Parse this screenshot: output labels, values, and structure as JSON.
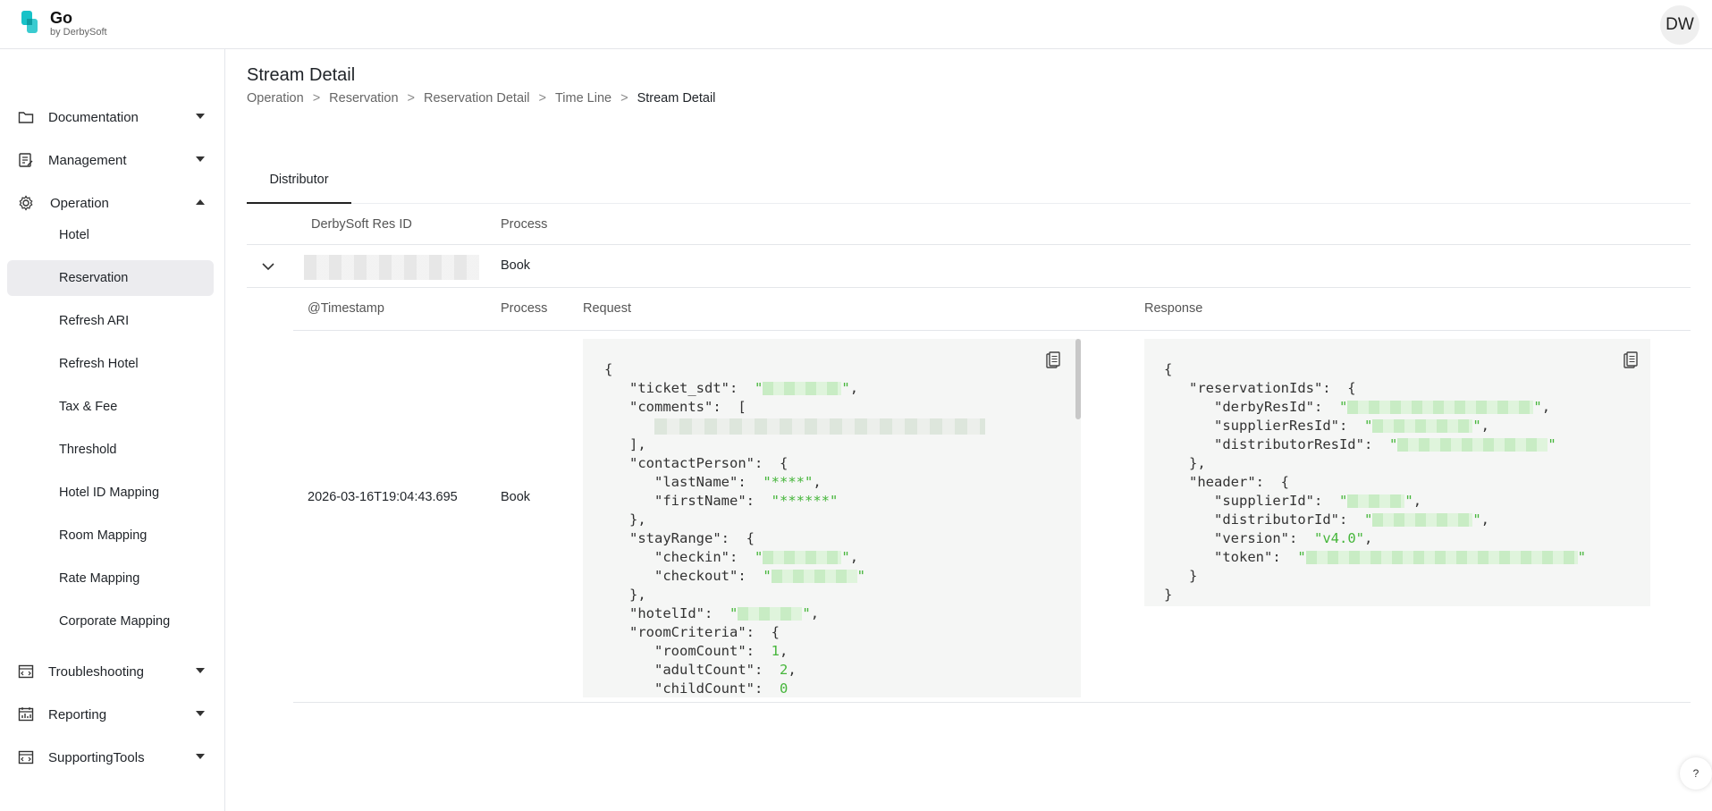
{
  "brand": {
    "name": "Go",
    "sub": "by DerbySoft",
    "logo_color": "#17c2c8"
  },
  "user": {
    "initials": "DW"
  },
  "sidebar": {
    "groups": [
      {
        "label": "Documentation",
        "icon": "folder-icon",
        "expanded": false
      },
      {
        "label": "Management",
        "icon": "edit-doc-icon",
        "expanded": false
      },
      {
        "label": "Operation",
        "icon": "gear-icon",
        "expanded": true
      },
      {
        "label": "Troubleshooting",
        "icon": "window-code-icon",
        "expanded": false
      },
      {
        "label": "Reporting",
        "icon": "calendar-chart-icon",
        "expanded": false
      },
      {
        "label": "SupportingTools",
        "icon": "window-code-icon",
        "expanded": false
      }
    ],
    "operation_items": [
      "Hotel",
      "Reservation",
      "Refresh ARI",
      "Refresh Hotel",
      "Tax & Fee",
      "Threshold",
      "Hotel ID Mapping",
      "Room Mapping",
      "Rate Mapping",
      "Corporate Mapping"
    ],
    "active_item": "Reservation"
  },
  "page": {
    "title": "Stream Detail",
    "breadcrumb": [
      "Operation",
      "Reservation",
      "Reservation Detail",
      "Time Line",
      "Stream Detail"
    ],
    "breadcrumb_sep": ">"
  },
  "tabs": {
    "active": "Distributor"
  },
  "table": {
    "headers": {
      "res_id": "DerbySoft Res ID",
      "process": "Process"
    },
    "row": {
      "process": "Book"
    },
    "sub_headers": {
      "timestamp": "@Timestamp",
      "process": "Process",
      "request": "Request",
      "response": "Response"
    },
    "sub_row": {
      "timestamp": "2026-03-16T19:04:43.695",
      "process": "Book"
    }
  },
  "request_json": {
    "lines": [
      "{",
      "\"ticket_sdt\":",
      "\"comments\":",
      "],",
      "\"contactPerson\":",
      "\"lastName\":",
      "\"firstName\":",
      "},",
      "\"stayRange\":",
      "\"checkin\":",
      "\"checkout\":",
      "},",
      "\"hotelId\":",
      "\"roomCriteria\":",
      "\"roomCount\":",
      "\"adultCount\":",
      "\"childCount\":"
    ],
    "values": {
      "lastName": "\"****\"",
      "firstName": "\"******\"",
      "roomCount": "1",
      "adultCount": "2",
      "childCount": "0"
    }
  },
  "response_json": {
    "keys": {
      "reservationIds": "\"reservationIds\":",
      "derbyResId": "\"derbyResId\":",
      "supplierResId": "\"supplierResId\":",
      "distributorResId": "\"distributorResId\":",
      "header": "\"header\":",
      "supplierId": "\"supplierId\":",
      "distributorId": "\"distributorId\":",
      "version": "\"version\":",
      "token": "\"token\":"
    },
    "values": {
      "version": "\"v4.0\""
    }
  },
  "help": {
    "label": "?"
  }
}
